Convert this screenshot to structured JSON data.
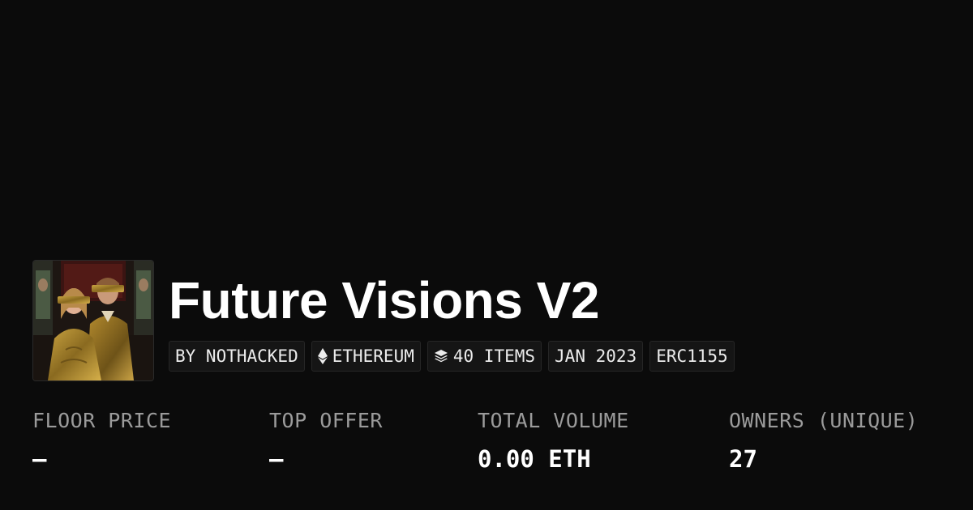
{
  "collection": {
    "title": "Future Visions V2",
    "thumbnail_alt": "collection-artwork",
    "pills": {
      "creator": "BY NOTHACKED",
      "chain": "ETHEREUM",
      "items": "40 ITEMS",
      "date": "JAN 2023",
      "standard": "ERC1155"
    },
    "icons": {
      "chain": "ethereum-icon",
      "items": "layers-icon"
    }
  },
  "stats": {
    "floor_price": {
      "label": "FLOOR PRICE",
      "value": "—"
    },
    "top_offer": {
      "label": "TOP OFFER",
      "value": "—"
    },
    "total_volume": {
      "label": "TOTAL VOLUME",
      "value": "0.00 ETH"
    },
    "owners": {
      "label": "OWNERS (UNIQUE)",
      "value": "27"
    }
  },
  "colors": {
    "background": "#0b0b0b",
    "text": "#ffffff",
    "muted": "#9b9b9b",
    "pill_bg": "#151515"
  }
}
